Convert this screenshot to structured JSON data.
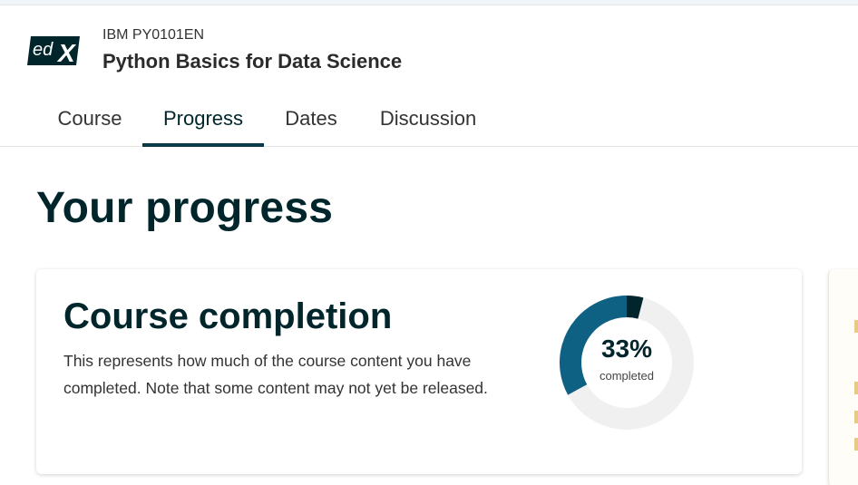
{
  "header": {
    "logo_icon": "edx-logo-icon",
    "course_org": "IBM PY0101EN",
    "course_title": "Python Basics for Data Science",
    "tabs": [
      {
        "label": "Course",
        "active": false
      },
      {
        "label": "Progress",
        "active": true
      },
      {
        "label": "Dates",
        "active": false
      },
      {
        "label": "Discussion",
        "active": false
      }
    ]
  },
  "main": {
    "heading": "Your progress",
    "completion_card": {
      "title": "Course completion",
      "description": "This represents how much of the course content you have completed. Note that some content may not yet be released.",
      "percent_label": "33%",
      "completed_label": "completed",
      "completed_fraction": 0.33,
      "locked_fraction": 0.04
    }
  },
  "colors": {
    "brand_dark": "#00262b",
    "progress_complete": "#0e6182",
    "progress_locked": "#00262b",
    "progress_remaining": "#f0f0f0"
  }
}
